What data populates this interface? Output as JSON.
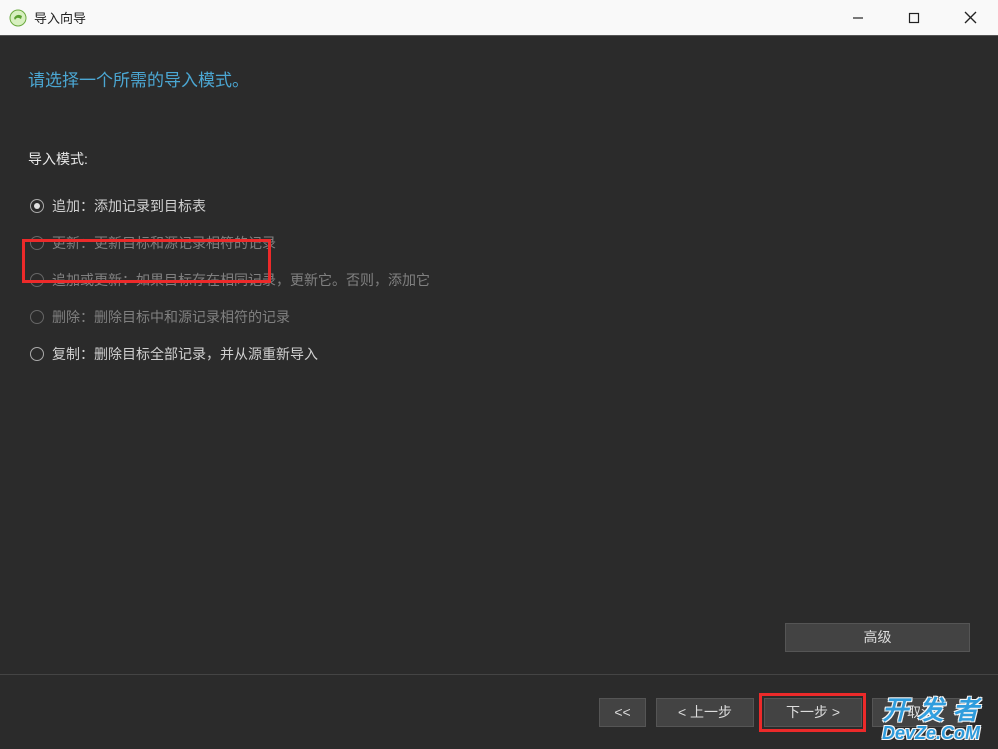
{
  "window": {
    "title": "导入向导"
  },
  "heading": "请选择一个所需的导入模式。",
  "mode_label": "导入模式:",
  "options": [
    {
      "label": "追加：添加记录到目标表",
      "selected": true,
      "disabled": false
    },
    {
      "label": "更新：更新目标和源记录相符的记录",
      "selected": false,
      "disabled": true
    },
    {
      "label": "追加或更新：如果目标存在相同记录，更新它。否则，添加它",
      "selected": false,
      "disabled": true
    },
    {
      "label": "删除：删除目标中和源记录相符的记录",
      "selected": false,
      "disabled": true
    },
    {
      "label": "复制：删除目标全部记录，并从源重新导入",
      "selected": false,
      "disabled": false
    }
  ],
  "advanced_btn": "高级",
  "footer": {
    "first": "<<",
    "prev": "< 上一步",
    "next": "下一步 >",
    "cancel": "取消"
  },
  "watermark": {
    "line1": "开 发 者",
    "line2": "DevZe.CoM"
  }
}
